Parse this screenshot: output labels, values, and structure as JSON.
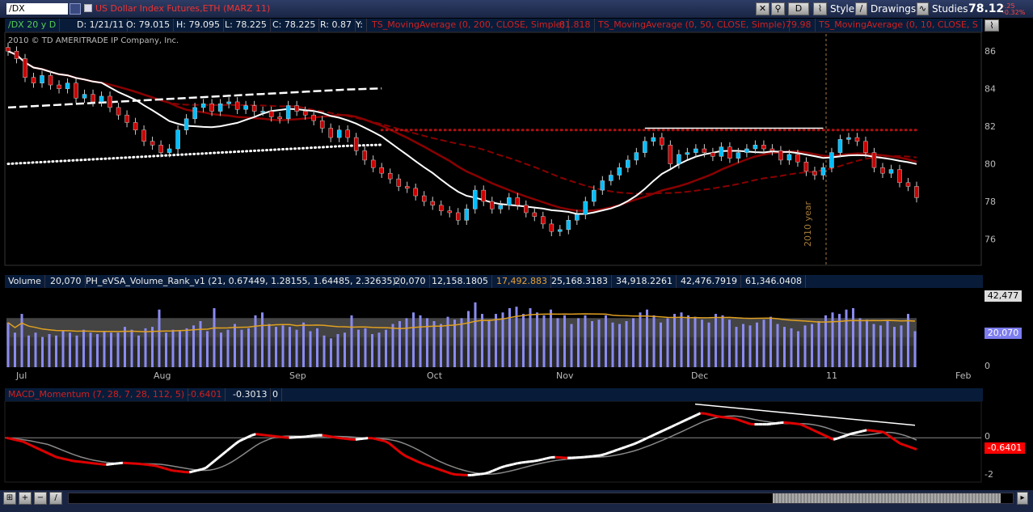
{
  "header": {
    "symbol": "/DX",
    "description": "US Dollar Index Futures,ETH (MARZ 11)",
    "btn_d": "D",
    "style_label": "Style",
    "drawings_label": "Drawings",
    "studies_label": "Studies",
    "last_price": "78.12",
    "change": "-.25",
    "change_pct": "-0.32%"
  },
  "info": {
    "period": "/DX 20 y D",
    "date": "D: 1/21/11",
    "open": "O: 79.015",
    "high": "H: 79.095",
    "low": "L: 78.225",
    "close": "C: 78.225",
    "range": "R: 0.87",
    "y": "Y:",
    "ma200": "TS_MovingAverage (0, 200, CLOSE, Simple)",
    "ma200_val": "81.818",
    "ma50": "TS_MovingAverage (0, 50, CLOSE, Simple)",
    "ma50_val": "79.98",
    "ma10": "TS_MovingAverage (0, 10, CLOSE, S",
    "copyright": "2010 © TD AMERITRADE IP Company, Inc.",
    "year_marker": "2010 year"
  },
  "volume_bar": {
    "label": "Volume",
    "value": "20,070",
    "study": "PH_eVSA_Volume_Rank_v1 (21, 0.67449, 1.28155, 1.64485, 2.32635)",
    "v1": "20,070",
    "v2": "12,158.1805",
    "v3": "17,492.883",
    "v4": "25,168.3183",
    "v5": "34,918.2261",
    "v6": "42,476.7919",
    "v7": "61,346.0408",
    "badge_top": "42,477",
    "badge_cur": "20,070",
    "zero": "0"
  },
  "macd_bar": {
    "label": "MACD_Momentum (7, 28, 7, 28, 112, 5)",
    "v1": "-0.6401",
    "v2": "-0.3013",
    "v3": "0",
    "badge": "-0.6401",
    "ticks": [
      "0",
      "-2"
    ]
  },
  "months": [
    "Jul",
    "Aug",
    "Sep",
    "Oct",
    "Nov",
    "Dec",
    "11",
    "Feb"
  ],
  "colors": {
    "bull": "#00bfff",
    "bear": "#cc0000",
    "ma": "#8b0000",
    "white": "#ffffff",
    "volume": "#8a8af0",
    "macd_up": "#ffffff",
    "macd_dn": "#e00000"
  },
  "chart_data": [
    {
      "type": "candlestick",
      "title": "US Dollar Index Futures,ETH (MARZ 11)",
      "y_ticks": [
        86,
        84,
        82,
        80,
        78,
        76
      ],
      "ylim": [
        74.6,
        87
      ],
      "close_series": [
        86.0,
        85.6,
        84.6,
        84.3,
        84.7,
        84.2,
        84.0,
        84.3,
        83.5,
        83.7,
        83.3,
        83.6,
        83.0,
        82.6,
        82.2,
        81.8,
        81.2,
        81.0,
        80.6,
        80.8,
        81.8,
        82.4,
        83.0,
        83.2,
        82.8,
        83.2,
        83.3,
        82.9,
        83.1,
        82.8,
        82.8,
        82.5,
        82.4,
        83.1,
        82.8,
        82.6,
        82.3,
        81.9,
        81.4,
        81.8,
        81.4,
        80.7,
        80.2,
        79.8,
        79.5,
        79.2,
        78.8,
        78.7,
        78.3,
        78.0,
        77.8,
        77.5,
        77.4,
        77.0,
        77.6,
        78.6,
        78.0,
        77.6,
        77.8,
        78.2,
        77.8,
        77.4,
        77.2,
        76.8,
        76.4,
        76.5,
        77.0,
        77.3,
        78.0,
        78.6,
        79.1,
        79.4,
        79.8,
        80.2,
        80.6,
        81.2,
        81.4,
        81.0,
        80.0,
        80.5,
        80.6,
        80.8,
        80.6,
        80.4,
        80.9,
        80.3,
        80.6,
        80.8,
        81.0,
        80.8,
        80.7,
        80.2,
        80.5,
        80.1,
        79.6,
        79.4,
        79.8,
        80.6,
        81.3,
        81.4,
        81.2,
        80.6,
        79.8,
        79.5,
        79.7,
        79.0,
        78.8,
        78.2
      ],
      "ma_lines": [
        "MA200 dotted",
        "MA50 dashed",
        "MA10 solid",
        "red MAs"
      ]
    },
    {
      "type": "bar",
      "title": "Volume",
      "y_ticks": [
        42477,
        20070,
        0
      ],
      "ylim": [
        0,
        55000
      ],
      "values": [
        31000,
        24000,
        37000,
        22000,
        24000,
        21000,
        23000,
        22000,
        25000,
        24000,
        22000,
        26000,
        24000,
        23000,
        25000,
        24000,
        24000,
        28000,
        26000,
        22000,
        27000,
        28000,
        40000,
        24000,
        26000,
        25000,
        27000,
        29000,
        32000,
        25000,
        41000,
        24000,
        26000,
        30000,
        26000,
        27000,
        36000,
        38000,
        30000,
        28000,
        29000,
        28000,
        26000,
        31000,
        25000,
        27000,
        22000,
        20000,
        23000,
        24000,
        36000,
        26000,
        27000,
        23000,
        24000,
        26000,
        30000,
        32000,
        34000,
        38000,
        36000,
        34000,
        32000,
        30000,
        35000,
        33000,
        34000,
        39000,
        45000,
        37000,
        33000,
        37000,
        38000,
        41000,
        42000,
        37000,
        41000,
        38000,
        36000,
        40000,
        34000,
        36000,
        30000,
        34000,
        36000,
        32000,
        33000,
        36000,
        31000,
        30000,
        32000,
        34000,
        38000,
        40000,
        36000,
        31000,
        34000,
        37000,
        38000,
        36000,
        35000,
        33000,
        31000,
        37000,
        36000,
        33000,
        28000,
        30000,
        29000,
        31000,
        33000,
        35000,
        30000,
        28000,
        27000,
        25000,
        29000,
        30000,
        32000,
        36000,
        38000,
        37000,
        40000,
        41000,
        34000,
        33000,
        30000,
        29000,
        32000,
        28000,
        29000,
        37000,
        25000
      ],
      "ma_line": "orange 20-day volume average"
    },
    {
      "type": "line",
      "title": "MACD_Momentum (7, 28, 7, 28, 112, 5)",
      "y_ticks": [
        0,
        -2
      ],
      "ylim": [
        -2.3,
        1.9
      ],
      "series": [
        {
          "name": "MACD_Momentum",
          "values": [
            0.0,
            -0.2,
            -0.6,
            -1.0,
            -1.2,
            -1.3,
            -1.4,
            -1.3,
            -1.35,
            -1.45,
            -1.7,
            -1.8,
            -1.6,
            -0.9,
            -0.2,
            0.2,
            0.1,
            0.0,
            0.05,
            0.15,
            0.0,
            -0.1,
            0.0,
            -0.2,
            -0.9,
            -1.3,
            -1.6,
            -1.9,
            -1.95,
            -1.85,
            -1.5,
            -1.3,
            -1.2,
            -1.0,
            -1.05,
            -1.0,
            -0.9,
            -0.6,
            -0.3,
            0.1,
            0.5,
            0.9,
            1.3,
            1.1,
            1.0,
            0.7,
            0.7,
            0.8,
            0.7,
            0.3,
            -0.1,
            0.2,
            0.4,
            0.3,
            -0.3,
            -0.6
          ]
        }
      ]
    }
  ]
}
